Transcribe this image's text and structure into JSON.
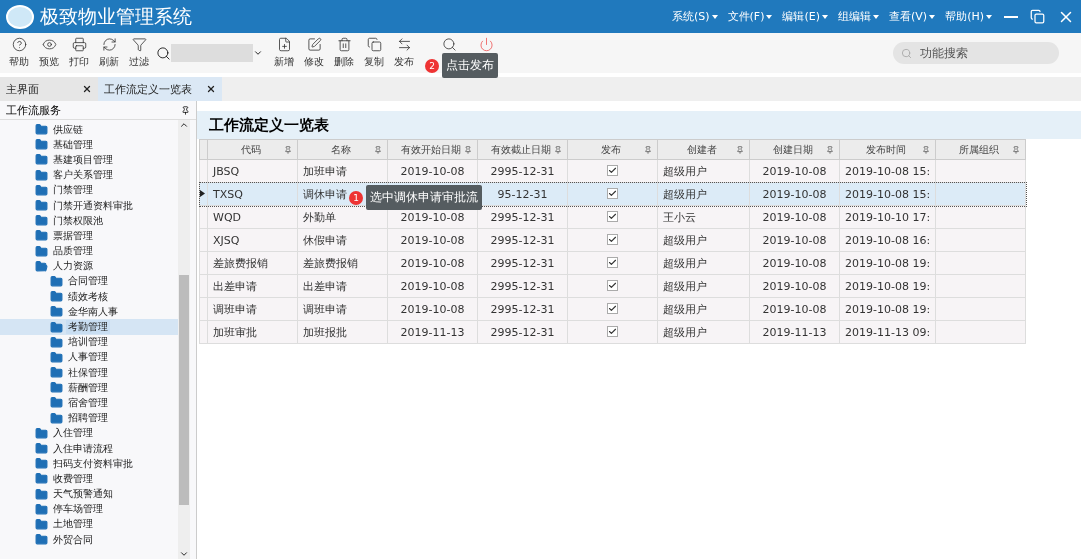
{
  "window": {
    "title": "极致物业管理系统",
    "menus": [
      "系统(S)",
      "文件(F)",
      "编辑(E)",
      "组编辑",
      "查看(V)",
      "帮助(H)"
    ]
  },
  "toolbar": {
    "left_buttons": [
      {
        "label": "帮助"
      },
      {
        "label": "预览"
      },
      {
        "label": "打印"
      },
      {
        "label": "刷新"
      },
      {
        "label": "过滤"
      }
    ],
    "right_buttons": [
      {
        "label": "新增"
      },
      {
        "label": "修改"
      },
      {
        "label": "删除"
      },
      {
        "label": "复制"
      },
      {
        "label": "发布"
      }
    ],
    "search": {
      "placeholder": "功能搜索"
    }
  },
  "tabs": [
    {
      "label": "主界面",
      "selected": false
    },
    {
      "label": "工作流定义一览表",
      "selected": true
    }
  ],
  "sidebar": {
    "title": "工作流服务",
    "items": [
      {
        "label": "供应链",
        "expanded": false,
        "selected": false
      },
      {
        "label": "基础管理",
        "expanded": false,
        "selected": false
      },
      {
        "label": "基建项目管理",
        "expanded": false,
        "selected": false
      },
      {
        "label": "客户关系管理",
        "expanded": false,
        "selected": false
      },
      {
        "label": "门禁管理",
        "expanded": false,
        "selected": false
      },
      {
        "label": "门禁开通资料审批",
        "expanded": false,
        "selected": false
      },
      {
        "label": "门禁权限池",
        "expanded": false,
        "selected": false
      },
      {
        "label": "票据管理",
        "expanded": false,
        "selected": false
      },
      {
        "label": "品质管理",
        "expanded": false,
        "selected": false
      },
      {
        "label": "人力资源",
        "expanded": true,
        "selected": false,
        "children": [
          {
            "label": "合同管理",
            "selected": false
          },
          {
            "label": "绩效考核",
            "selected": false
          },
          {
            "label": "金华南人事",
            "selected": false
          },
          {
            "label": "考勤管理",
            "selected": true
          },
          {
            "label": "培训管理",
            "selected": false
          },
          {
            "label": "人事管理",
            "selected": false
          },
          {
            "label": "社保管理",
            "selected": false
          },
          {
            "label": "薪酬管理",
            "selected": false
          },
          {
            "label": "宿舍管理",
            "selected": false
          },
          {
            "label": "招聘管理",
            "selected": false
          }
        ]
      },
      {
        "label": "入住管理",
        "expanded": false,
        "selected": false
      },
      {
        "label": "入住申请流程",
        "expanded": false,
        "selected": false
      },
      {
        "label": "扫码支付资料审批",
        "expanded": false,
        "selected": false
      },
      {
        "label": "收费管理",
        "expanded": false,
        "selected": false
      },
      {
        "label": "天气预警通知",
        "expanded": false,
        "selected": false
      },
      {
        "label": "停车场管理",
        "expanded": false,
        "selected": false
      },
      {
        "label": "土地管理",
        "expanded": false,
        "selected": false
      },
      {
        "label": "外贸合同",
        "expanded": false,
        "selected": false
      }
    ]
  },
  "main": {
    "title": "工作流定义一览表",
    "table": {
      "columns": [
        "代码",
        "名称",
        "有效开始日期",
        "有效截止日期",
        "发布",
        "创建者",
        "创建日期",
        "发布时间",
        "所属组织"
      ],
      "rows": [
        {
          "selected": false,
          "code": "JBSQ",
          "name": "加班申请",
          "start_date": "2019-10-08",
          "end_date": "2995-12-31",
          "published": true,
          "creator": "超级用户",
          "created": "2019-10-08",
          "publish_time": "2019-10-08 15:"
        },
        {
          "selected": true,
          "code": "TXSQ",
          "name": "调休申请",
          "end_date": "95-12-31",
          "published": true,
          "creator": "超级用户",
          "created": "2019-10-08",
          "publish_time": "2019-10-08 15:"
        },
        {
          "selected": false,
          "code": "WQD",
          "name": "外勤单",
          "start_date": "2019-10-08",
          "end_date": "2995-12-31",
          "published": true,
          "creator": "王小云",
          "created": "2019-10-08",
          "publish_time": "2019-10-10 17:"
        },
        {
          "selected": false,
          "code": "XJSQ",
          "name": "休假申请",
          "start_date": "2019-10-08",
          "end_date": "2995-12-31",
          "published": true,
          "creator": "超级用户",
          "created": "2019-10-08",
          "publish_time": "2019-10-08 16:"
        },
        {
          "selected": false,
          "code": "差旅费报销",
          "name": "差旅费报销",
          "start_date": "2019-10-08",
          "end_date": "2995-12-31",
          "published": true,
          "creator": "超级用户",
          "created": "2019-10-08",
          "publish_time": "2019-10-08 19:"
        },
        {
          "selected": false,
          "code": "出差申请",
          "name": "出差申请",
          "start_date": "2019-10-08",
          "end_date": "2995-12-31",
          "published": true,
          "creator": "超级用户",
          "created": "2019-10-08",
          "publish_time": "2019-10-08 19:"
        },
        {
          "selected": false,
          "code": "调班申请",
          "name": "调班申请",
          "start_date": "2019-10-08",
          "end_date": "2995-12-31",
          "published": true,
          "creator": "超级用户",
          "created": "2019-10-08",
          "publish_time": "2019-10-08 19:"
        },
        {
          "selected": false,
          "code": "加班审批",
          "name": "加班报批",
          "start_date": "2019-11-13",
          "end_date": "2995-12-31",
          "published": true,
          "creator": "超级用户",
          "created": "2019-11-13",
          "publish_time": "2019-11-13 09:"
        }
      ]
    }
  },
  "annotations": [
    {
      "badge": "2",
      "text": "点击发布"
    },
    {
      "badge": "1",
      "text": "选中调休申请审批流"
    }
  ]
}
